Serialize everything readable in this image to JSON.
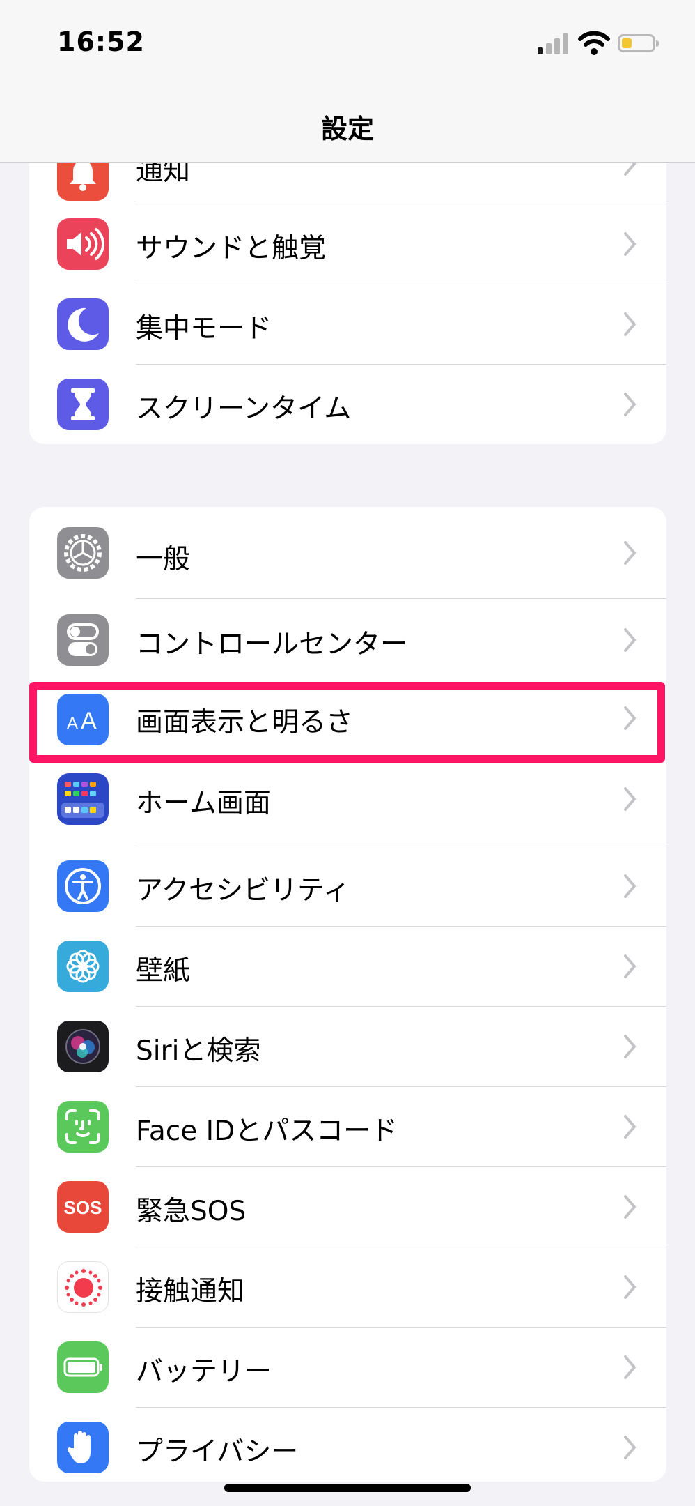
{
  "status_bar": {
    "time": "16:52"
  },
  "nav": {
    "title": "設定"
  },
  "group1": [
    {
      "label": "通知",
      "icon": "bell-icon",
      "color": "#eb4e3d"
    },
    {
      "label": "サウンドと触覚",
      "icon": "speaker-icon",
      "color": "#eb445a"
    },
    {
      "label": "集中モード",
      "icon": "moon-icon",
      "color": "#5e5ce6"
    },
    {
      "label": "スクリーンタイム",
      "icon": "hourglass-icon",
      "color": "#5e5ce6"
    }
  ],
  "group2": [
    {
      "label": "一般",
      "icon": "gear-icon",
      "color": "#8e8e93"
    },
    {
      "label": "コントロールセンター",
      "icon": "toggles-icon",
      "color": "#8e8e93"
    },
    {
      "label": "画面表示と明るさ",
      "icon": "text-size-icon",
      "color": "#3478f6"
    },
    {
      "label": "ホーム画面",
      "icon": "home-grid-icon",
      "color": "#2b47c6"
    },
    {
      "label": "アクセシビリティ",
      "icon": "accessibility-icon",
      "color": "#3478f6"
    },
    {
      "label": "壁紙",
      "icon": "flower-icon",
      "color": "#37aadc"
    },
    {
      "label": "Siriと検索",
      "icon": "siri-icon",
      "color": "#1c1c1e"
    },
    {
      "label": "Face IDとパスコード",
      "icon": "face-id-icon",
      "color": "#5ac85a"
    },
    {
      "label": "緊急SOS",
      "icon": "sos-icon",
      "color": "#e8483a"
    },
    {
      "label": "接触通知",
      "icon": "exposure-icon",
      "color": "#ffffff"
    },
    {
      "label": "バッテリー",
      "icon": "battery-icon",
      "color": "#5ac85a"
    },
    {
      "label": "プライバシー",
      "icon": "hand-icon",
      "color": "#3478f6"
    }
  ],
  "sos_icon_text": "SOS",
  "highlight_color": "#ff1564"
}
